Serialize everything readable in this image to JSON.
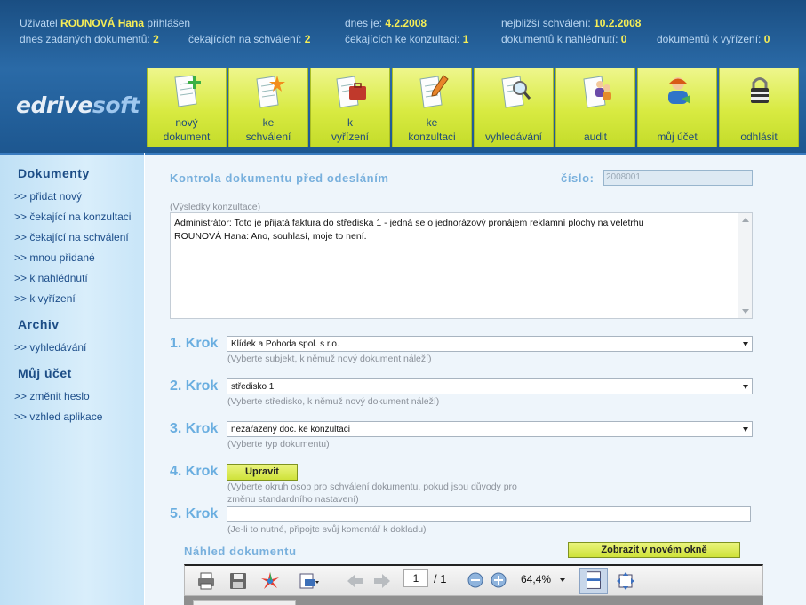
{
  "header": {
    "user_prefix": "Uživatel",
    "user_name": "ROUNOVÁ Hana",
    "user_suffix": "přihlášen",
    "today_label": "dnes je:",
    "today_value": "4.2.2008",
    "nearest_label": "nejbližší schválení:",
    "nearest_value": "10.2.2008",
    "entered_label": "dnes zadaných dokumentů:",
    "entered_value": "2",
    "waiting_approve_label": "čekajících na schválení:",
    "waiting_approve_value": "2",
    "waiting_consult_label": "čekajících ke konzultaci:",
    "waiting_consult_value": "1",
    "docs_view_label": "dokumentů k nahlédnutí:",
    "docs_view_value": "0",
    "docs_resolve_label": "dokumentů k vyřízení:",
    "docs_resolve_value": "0",
    "logo_a": "edrive",
    "logo_b": "soft"
  },
  "nav": [
    {
      "line1": "nový",
      "line2": "dokument",
      "icon": "new-document-icon"
    },
    {
      "line1": "ke",
      "line2": "schválení",
      "icon": "star-document-icon"
    },
    {
      "line1": "k",
      "line2": "vyřízení",
      "icon": "briefcase-document-icon"
    },
    {
      "line1": "ke",
      "line2": "konzultaci",
      "icon": "pencil-document-icon"
    },
    {
      "line1": "",
      "line2": "vyhledávání",
      "icon": "magnifier-document-icon"
    },
    {
      "line1": "",
      "line2": "audit",
      "icon": "people-document-icon"
    },
    {
      "line1": "",
      "line2": "můj účet",
      "icon": "user-icon"
    },
    {
      "line1": "",
      "line2": "odhlásit",
      "icon": "padlock-icon"
    }
  ],
  "sidebar": {
    "section1": "Dokumenty",
    "items1": [
      ">> přidat nový",
      ">> čekající na konzultaci",
      ">> čekající na schválení",
      ">> mnou přidané",
      ">> k nahlédnutí",
      ">> k vyřízení"
    ],
    "section2": "Archiv",
    "items2": [
      ">> vyhledávání"
    ],
    "section3": "Můj účet",
    "items3": [
      ">> změnit heslo",
      ">> vzhled aplikace"
    ]
  },
  "main": {
    "title": "Kontrola dokumentu před odesláním",
    "cislo_label": "číslo:",
    "cislo_value": "2008001",
    "consult_label": "(Výsledky konzultace)",
    "consult_line1": "Administrátor: Toto je přijatá faktura do střediska 1 - jedná se o jednorázový pronájem reklamní plochy na veletrhu",
    "consult_line2": "ROUNOVÁ Hana: Ano, souhlasí, moje to není.",
    "step1_label": "1. Krok",
    "step1_value": "Klídek a Pohoda spol. s r.o.",
    "step1_hint": "(Vyberte subjekt, k němuž nový dokument náleží)",
    "step2_label": "2. Krok",
    "step2_value": "středisko 1",
    "step2_hint": "(Vyberte středisko, k němuž nový dokument náleží)",
    "step3_label": "3. Krok",
    "step3_value": "nezařazený doc. ke konzultaci",
    "step3_hint": "(Vyberte typ dokumentu)",
    "step4_label": "4. Krok",
    "step4_button": "Upravit",
    "step4_hint1": "(Vyberte okruh osob pro schválení dokumentu, pokud jsou důvody pro",
    "step4_hint2": "změnu standardního nastavení)",
    "step5_label": "5. Krok",
    "step5_value": "",
    "step5_hint": "(Je-li to nutné, připojte svůj komentář k dokladu)",
    "preview_title": "Náhled dokumentu",
    "preview_button": "Zobrazit v novém okně"
  },
  "pdf": {
    "page": "1",
    "total": "/ 1",
    "zoom": "64,4%"
  },
  "colors": {
    "header_blue": "#1d5790",
    "accent_yellow": "#f7ee56",
    "nav_green": "#d8ea41",
    "step_blue": "#6aaee0"
  }
}
